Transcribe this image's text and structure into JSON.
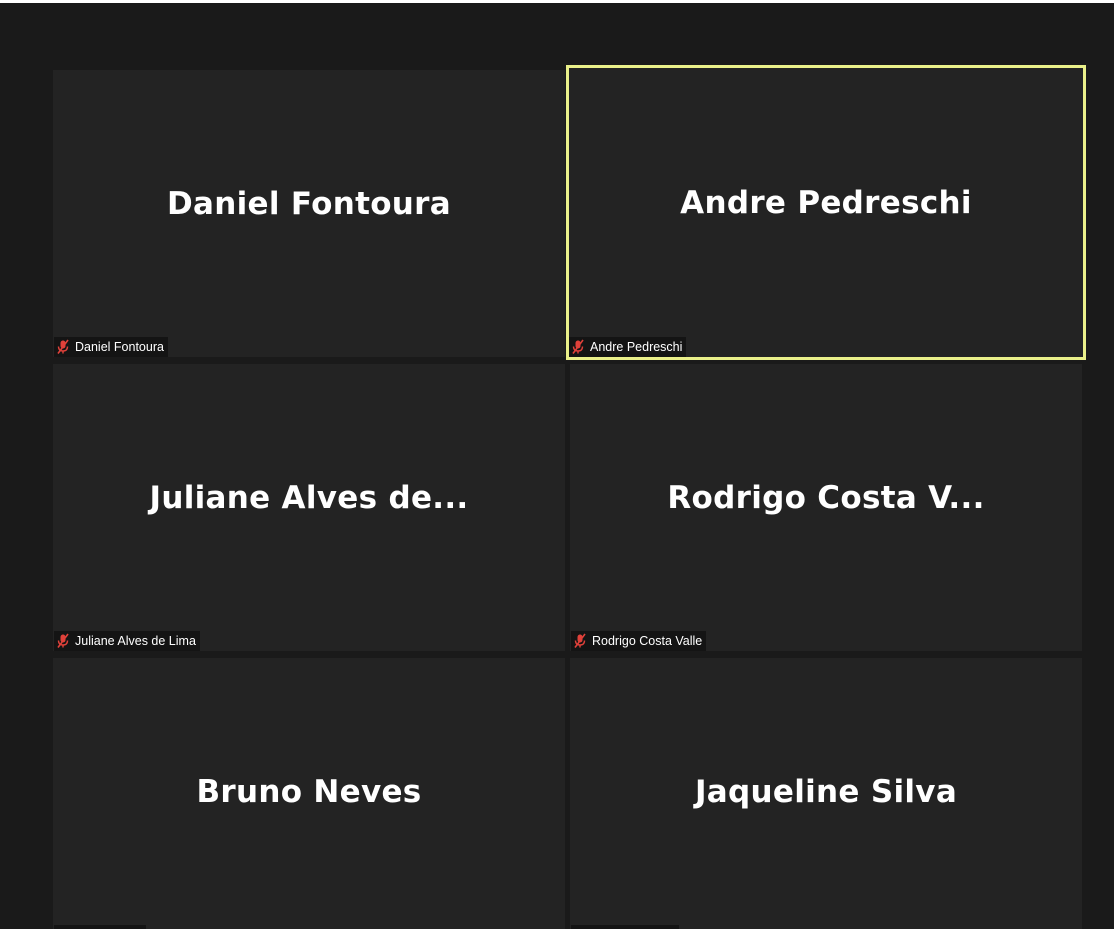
{
  "participants": [
    {
      "display_name": "Daniel Fontoura",
      "label": "Daniel Fontoura",
      "muted": true,
      "active_speaker": false
    },
    {
      "display_name": "Andre Pedreschi",
      "label": "Andre Pedreschi",
      "muted": true,
      "active_speaker": true
    },
    {
      "display_name": "Juliane Alves de...",
      "label": "Juliane Alves de Lima",
      "muted": true,
      "active_speaker": false
    },
    {
      "display_name": "Rodrigo Costa V...",
      "label": "Rodrigo Costa Valle",
      "muted": true,
      "active_speaker": false
    },
    {
      "display_name": "Bruno Neves",
      "label": "",
      "muted": true,
      "active_speaker": false
    },
    {
      "display_name": "Jaqueline Silva",
      "label": "",
      "muted": true,
      "active_speaker": false
    }
  ],
  "icons": {
    "muted_mic": "muted-mic-icon"
  },
  "colors": {
    "background": "#1a1a1a",
    "tile": "#232323",
    "active_speaker_border": "#eaf08a",
    "speaking_glow": "#6ecb12",
    "muted_icon": "#e0413a"
  }
}
